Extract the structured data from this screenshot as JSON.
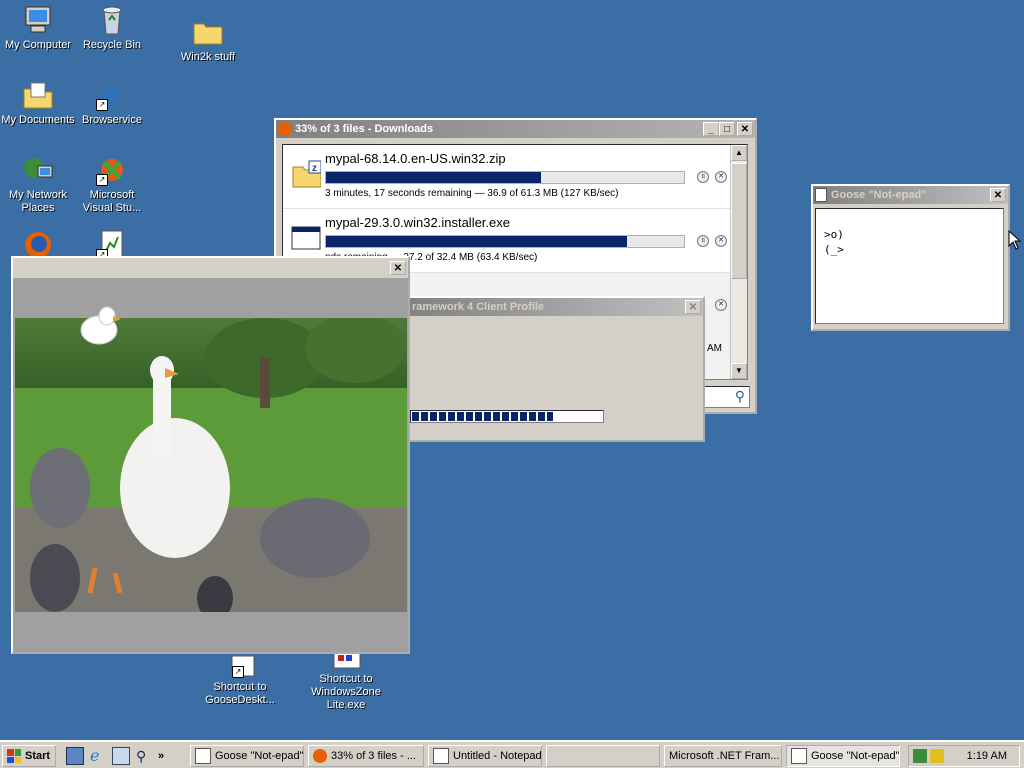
{
  "desktop": {
    "icons": [
      {
        "label": "My Computer"
      },
      {
        "label": "Recycle Bin"
      },
      {
        "label": "Win2k stuff"
      },
      {
        "label": "My Documents"
      },
      {
        "label": "Browservice"
      },
      {
        "label": "My Network Places"
      },
      {
        "label": "Microsoft Visual Stu..."
      },
      {
        "label": "Shortcut to GooseDeskt..."
      },
      {
        "label": "Shortcut to WindowsZone Lite.exe"
      }
    ]
  },
  "downloads": {
    "title": "33% of 3 files - Downloads",
    "items": [
      {
        "name": "mypal-68.14.0.en-US.win32.zip",
        "progress": 0.6,
        "status": "3 minutes, 17 seconds remaining — 36.9 of 61.3 MB (127 KB/sec)"
      },
      {
        "name": "mypal-29.3.0.win32.installer.exe",
        "progress": 0.84,
        "status": "nds remaining — 27.2 of 32.4 MB (63.4 KB/sec)"
      },
      {
        "name": "",
        "progress": null,
        "status": "AM"
      }
    ]
  },
  "goose_notepad": {
    "title": "Goose \"Not-epad\"",
    "line1": ">o)",
    "line2": "(_>"
  },
  "dotnet": {
    "title": "ramework 4 Client Profile",
    "progress": 0.74
  },
  "goose_gif": {
    "title": ""
  },
  "taskbar": {
    "start": "Start",
    "chevron": "»",
    "buttons": [
      {
        "label": "Goose \"Not-epad\""
      },
      {
        "label": "33% of 3 files - ..."
      },
      {
        "label": "Untitled - Notepad"
      },
      {
        "label": ""
      },
      {
        "label": "Microsoft .NET Fram..."
      },
      {
        "label": "Goose \"Not-epad\""
      }
    ],
    "clock": "1:19 AM"
  },
  "colors": {
    "desktop": "#3a6ea5",
    "title_active": "#0a246a",
    "progress": "#0a246a"
  }
}
